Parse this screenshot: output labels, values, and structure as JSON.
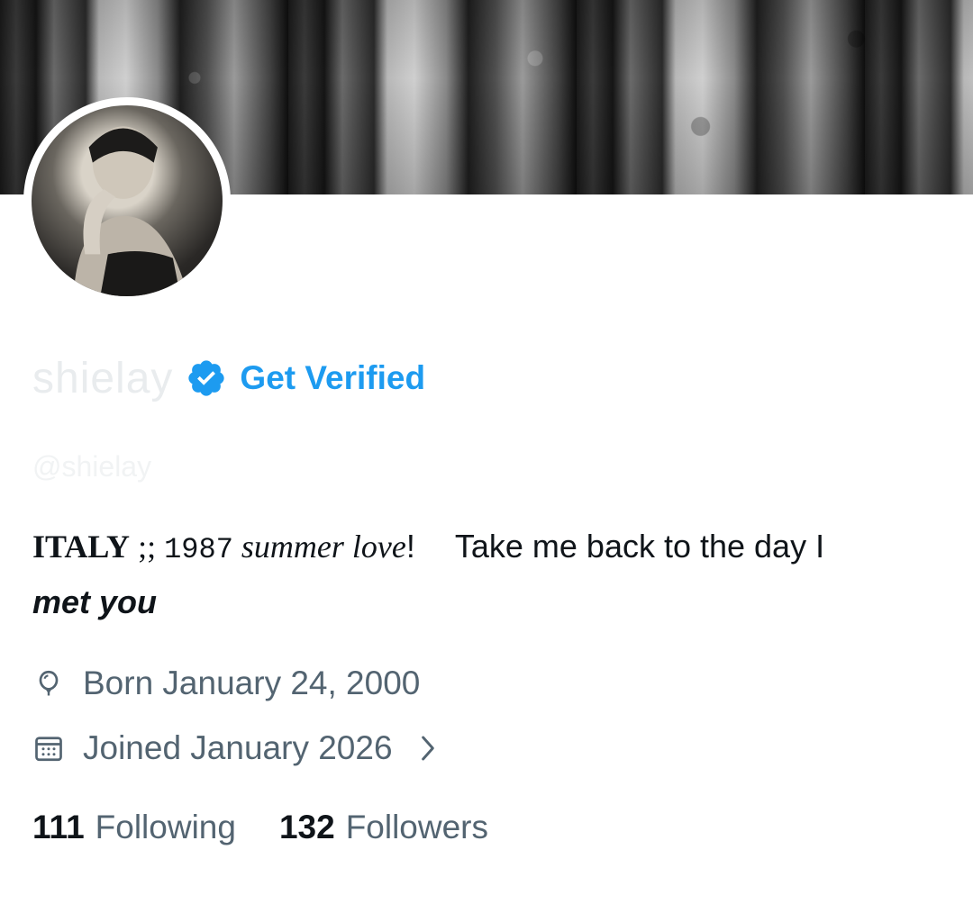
{
  "profile": {
    "display_name": "shielay",
    "handle": "@shielay",
    "get_verified_label": "Get Verified"
  },
  "bio": {
    "italy": "ITALY",
    "semicolons": " ;; ",
    "year": "1987",
    "summer_love": " summer love",
    "exclaim": "!",
    "take_me_back": "Take me back to the day I",
    "met_you": "met you"
  },
  "meta": {
    "born": "Born January 24, 2000",
    "joined": "Joined January 2026"
  },
  "stats": {
    "following_count": "111",
    "following_label": "Following",
    "followers_count": "132",
    "followers_label": "Followers"
  },
  "colors": {
    "accent": "#1d9bf0",
    "secondary_text": "#536471",
    "primary_text": "#0f1419"
  }
}
